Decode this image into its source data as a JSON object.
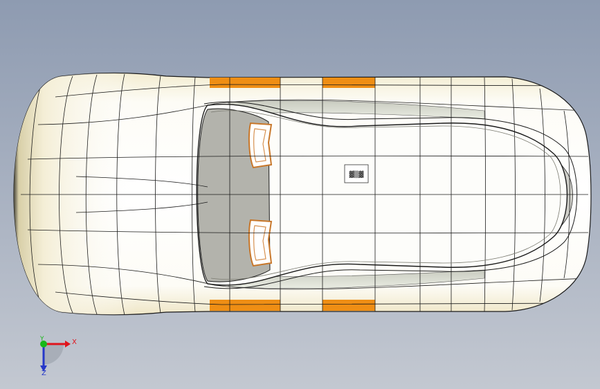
{
  "viewport": {
    "background_top": "#8e9bb1",
    "background_bottom": "#c3c8d1"
  },
  "model": {
    "body_color": "#fbfbf4",
    "shade_color": "#e8e3c9",
    "glass_color": "#b3b3ac",
    "accent_color": "#ef8e14",
    "edge_color": "#1a1a1a",
    "decal_text": "▓▒▓"
  },
  "triad": {
    "x_label": "X",
    "y_label": "Y",
    "z_label": "Z",
    "x_color": "#e0141c",
    "y_color": "#18b818",
    "z_color": "#2638c8"
  }
}
